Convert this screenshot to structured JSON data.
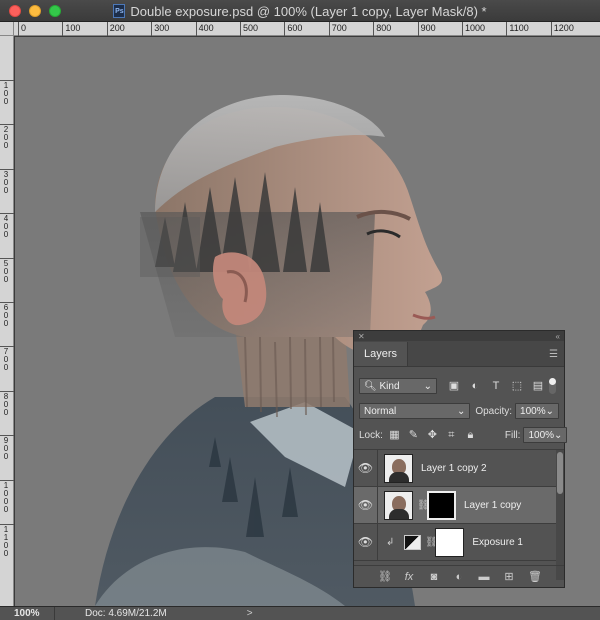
{
  "window": {
    "title": "Double exposure.psd @ 100% (Layer 1 copy, Layer Mask/8) *",
    "file_icon": "psd-icon"
  },
  "rulers": {
    "top_labels": [
      "0",
      "100",
      "200",
      "300",
      "400",
      "500",
      "600",
      "700",
      "800",
      "900",
      "1000",
      "1100",
      "1200"
    ],
    "left_labels": [
      "1 0 0",
      "2 0 0",
      "3 0 0",
      "4 0 0",
      "5 0 0",
      "6 0 0",
      "7 0 0",
      "8 0 0",
      "9 0 0",
      "1 0 0 0",
      "1 1 0 0"
    ]
  },
  "status": {
    "zoom": "100%",
    "doc": "Doc: 4.69M/21.2M",
    "arrow": ">"
  },
  "layers_panel": {
    "tab_label": "Layers",
    "filter_kind": "Kind",
    "blend_mode": "Normal",
    "opacity_label": "Opacity:",
    "opacity_value": "100%",
    "lock_label": "Lock:",
    "fill_label": "Fill:",
    "fill_value": "100%",
    "layers": [
      {
        "name": "Layer 1 copy 2",
        "visible": true,
        "selected": false
      },
      {
        "name": "Layer 1 copy",
        "visible": true,
        "selected": true,
        "mask": "black"
      },
      {
        "name": "Exposure 1",
        "visible": true,
        "selected": false,
        "mask": "white",
        "adjustment": true
      }
    ]
  },
  "colors": {
    "canvas_bg": "#7a7a7a",
    "panel_bg": "#535353",
    "selected_layer": "#6a6a6a"
  }
}
